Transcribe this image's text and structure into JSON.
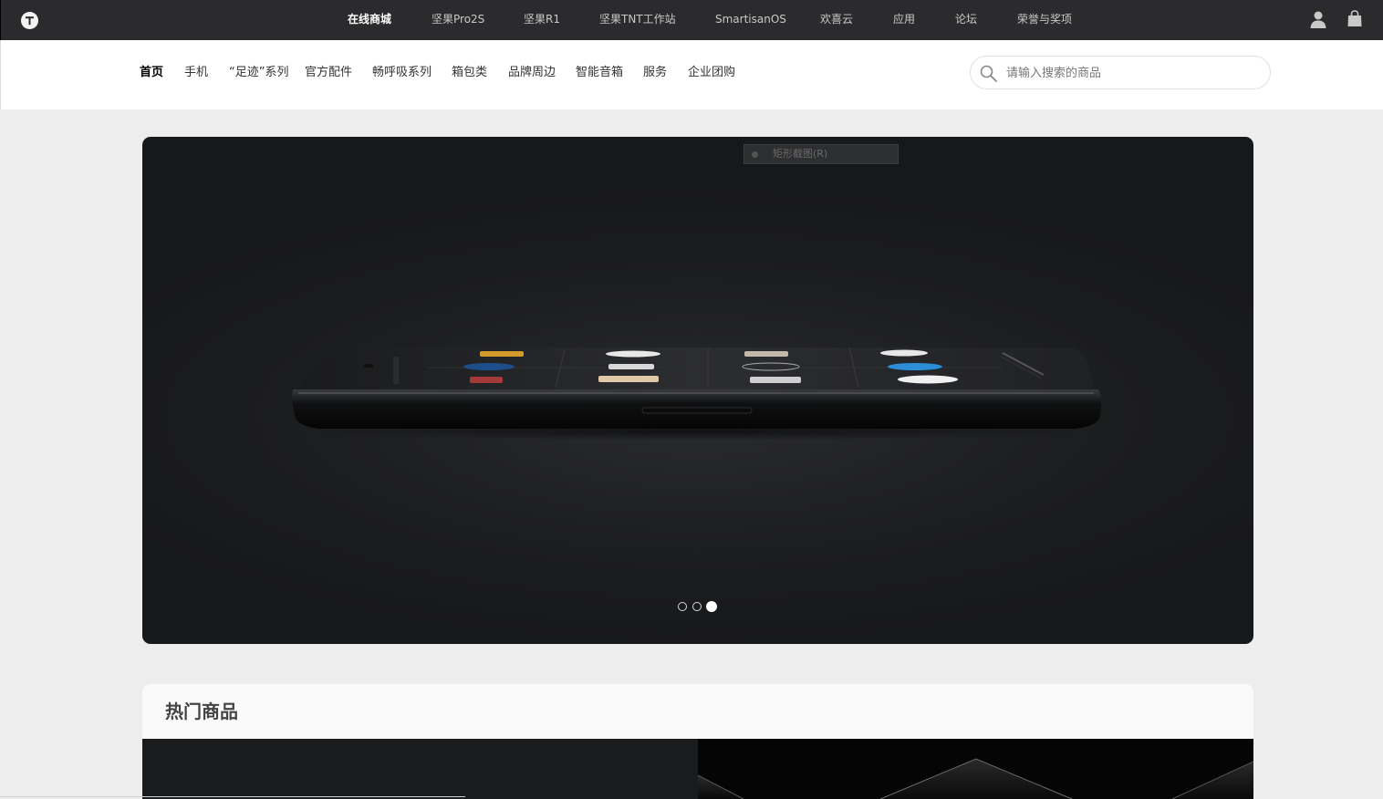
{
  "topbar": {
    "logo_icon": "smartisan-t-logo-icon",
    "nav": [
      {
        "label": "在线商城",
        "active": true
      },
      {
        "label": "坚果Pro2S",
        "active": false
      },
      {
        "label": "坚果R1",
        "active": false
      },
      {
        "label": "坚果TNT工作站",
        "active": false
      },
      {
        "label": "SmartisanOS",
        "active": false
      },
      {
        "label": "欢喜云",
        "active": false
      },
      {
        "label": "应用",
        "active": false
      },
      {
        "label": "论坛",
        "active": false
      },
      {
        "label": "荣誉与奖项",
        "active": false
      }
    ],
    "user_icon": "user-icon",
    "cart_icon": "shopping-bag-icon"
  },
  "subnav": {
    "items": [
      {
        "label": "首页",
        "active": true
      },
      {
        "label": "手机",
        "active": false
      },
      {
        "label": "“足迹”系列",
        "active": false
      },
      {
        "label": "官方配件",
        "active": false
      },
      {
        "label": "畅呼吸系列",
        "active": false
      },
      {
        "label": "箱包类",
        "active": false
      },
      {
        "label": "品牌周边",
        "active": false
      },
      {
        "label": "智能音箱",
        "active": false
      },
      {
        "label": "服务",
        "active": false
      },
      {
        "label": "企业团购",
        "active": false
      }
    ],
    "search": {
      "placeholder": "请输入搜索的商品",
      "value": "",
      "icon": "search-icon"
    }
  },
  "banner": {
    "tooltip": "矩形截图(R)",
    "slide_count": 3,
    "active_slide": 3
  },
  "hot": {
    "title": "热门商品"
  },
  "colors": {
    "topbar_bg": "#2b2b2d",
    "page_bg": "#ededed",
    "banner_bg": "#1d1e20"
  }
}
